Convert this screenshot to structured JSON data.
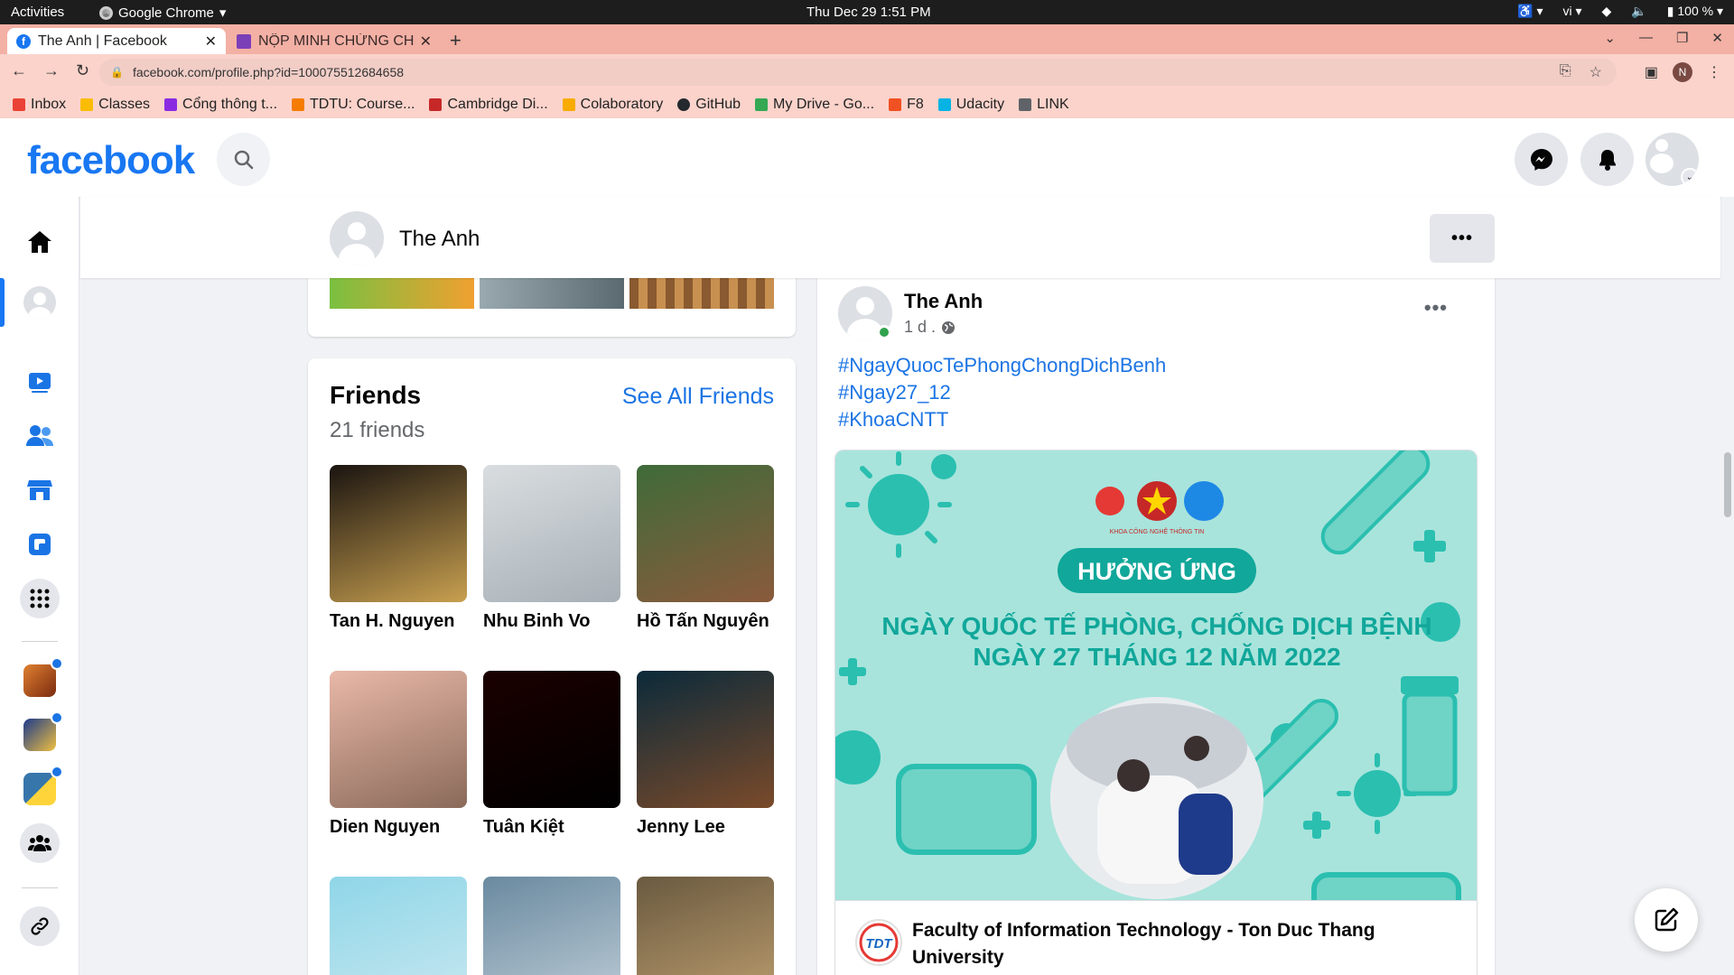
{
  "system_bar": {
    "activities": "Activities",
    "app_name": "Google Chrome",
    "clock": "Thu Dec 29   1:51 PM",
    "language": "vi",
    "battery": "100 %"
  },
  "browser": {
    "tabs": [
      {
        "label": "The Anh | Facebook",
        "active": true
      },
      {
        "label": "NỘP MINH CHỨNG CH",
        "active": false
      }
    ],
    "url": "facebook.com/profile.php?id=100075512684658",
    "profile_initial": "N",
    "bookmarks": [
      {
        "label": "Inbox",
        "color": "#ea4335"
      },
      {
        "label": "Classes",
        "color": "#fbbc04"
      },
      {
        "label": "Cổng thông t...",
        "color": "#8a2be2"
      },
      {
        "label": "TDTU: Course...",
        "color": "#f57c00"
      },
      {
        "label": "Cambridge Di...",
        "color": "#c62828"
      },
      {
        "label": "Colaboratory",
        "color": "#f9ab00"
      },
      {
        "label": "GitHub",
        "color": "#24292e"
      },
      {
        "label": "My Drive - Go...",
        "color": "#34a853"
      },
      {
        "label": "F8",
        "color": "#f05123"
      },
      {
        "label": "Udacity",
        "color": "#02b3e4"
      },
      {
        "label": "LINK",
        "color": "#5f6368"
      }
    ]
  },
  "facebook": {
    "logo_text": "facebook",
    "accent_color": "#1877f2",
    "profile_name": "The Anh"
  },
  "friends": {
    "title": "Friends",
    "count_text": "21 friends",
    "see_all": "See All Friends",
    "list": [
      {
        "name": "Tan H. Nguyen",
        "colors": [
          "#1a1410",
          "#c8a050"
        ]
      },
      {
        "name": "Nhu Binh Vo",
        "colors": [
          "#d9dde0",
          "#a7b0b6"
        ]
      },
      {
        "name": "Hồ Tấn Nguyên",
        "colors": [
          "#3f6b3a",
          "#8a5a3c"
        ]
      },
      {
        "name": "Dien Nguyen",
        "colors": [
          "#e9b8a8",
          "#8a6a5a"
        ]
      },
      {
        "name": "Tuân Kiệt",
        "colors": [
          "#1a0000",
          "#000000"
        ]
      },
      {
        "name": "Jenny Lee",
        "colors": [
          "#0b2a3a",
          "#7a4a2a"
        ]
      },
      {
        "name": "",
        "colors": [
          "#8fd6e8",
          "#c8e8f0"
        ]
      },
      {
        "name": "",
        "colors": [
          "#6a8aa0",
          "#c0ced8"
        ]
      },
      {
        "name": "",
        "colors": [
          "#6a5a40",
          "#c0a070"
        ]
      }
    ]
  },
  "post": {
    "author": "The Anh",
    "time": "1 d .",
    "hashtags": [
      "#NgayQuocTePhongChongDichBenh",
      "#Ngay27_12",
      "#KhoaCNTT"
    ],
    "image": {
      "banner": "HƯỞNG ỨNG",
      "line1": "NGÀY QUỐC TẾ PHÒNG, CHỐNG DỊCH BỆNH",
      "line2": "NGÀY 27 THÁNG 12 NĂM 2022",
      "org_label": "KHOA CÔNG NGHỆ THÔNG TIN",
      "bg_color": "#a8e4dc",
      "teal": "#2bbfb0"
    },
    "link_title": "Faculty of Information Technology - Ton Duc Thang University",
    "link_logo_text": "TDT"
  }
}
